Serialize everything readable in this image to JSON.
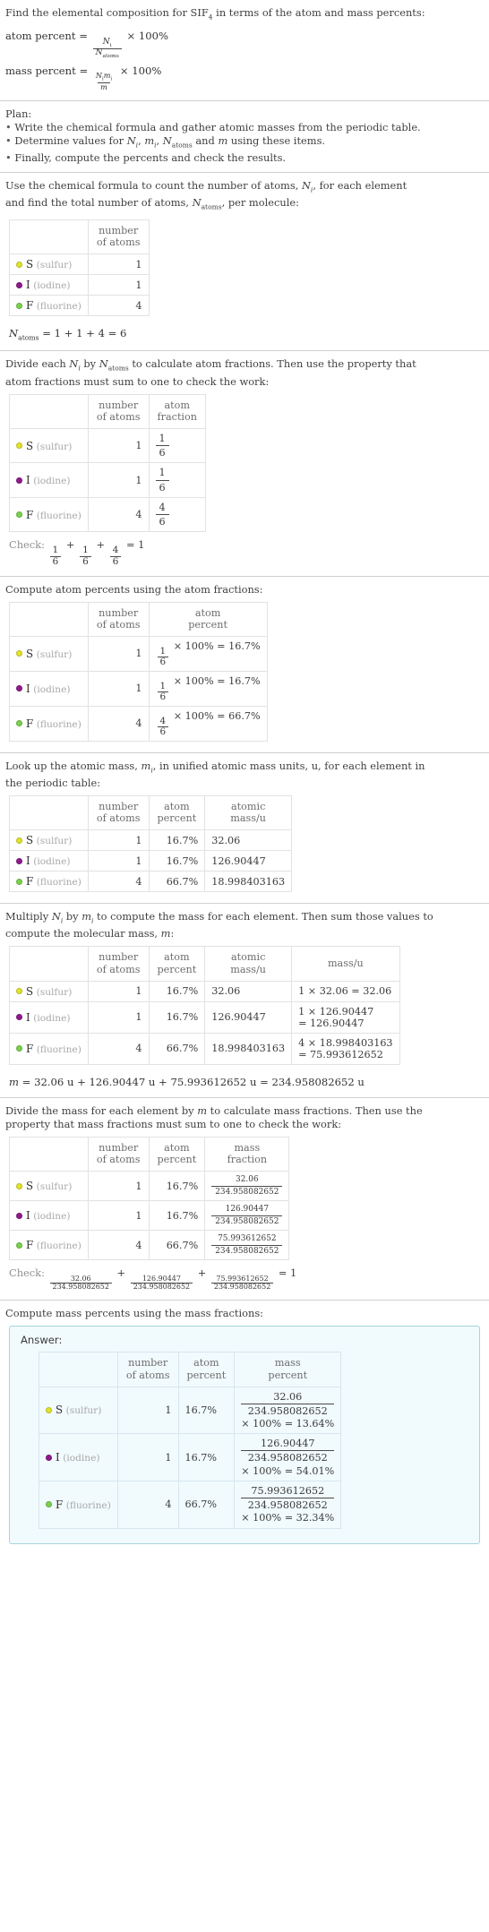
{
  "colors": {
    "sulfur": "#e3e32a",
    "iodine": "#8e1a8e",
    "fluorine": "#79d24f",
    "answer_border": "#a8d4de",
    "answer_bg": "#f1fafd",
    "rule": "#cfcfcf"
  },
  "header": {
    "prompt_prefix": "Find the elemental composition for SIF",
    "formula_sub": "4",
    "prompt_suffix": " in terms of the atom and mass percents:",
    "atom_percent_label": "atom percent = ",
    "atom_percent_num": "N",
    "atom_percent_num_sub": "i",
    "atom_percent_den": "N",
    "atom_percent_den_sub": "atoms",
    "atom_percent_tail": "× 100%",
    "mass_percent_label": "mass percent = ",
    "mass_percent_num": "N",
    "mass_percent_num_sub": "i",
    "mass_percent_num2": "m",
    "mass_percent_num2_sub": "i",
    "mass_percent_den": "m",
    "mass_percent_tail": "× 100%"
  },
  "plan": {
    "title": "Plan:",
    "bullets": [
      "Write the chemical formula and gather atomic masses from the periodic table.",
      "Determine values for Ni, mi, Natoms and m using these items.",
      "Finally, compute the percents and check the results."
    ],
    "bullet2_parts": {
      "a": "Determine values for ",
      "b": "N",
      "b_sub": "i",
      "c": ", ",
      "d": "m",
      "d_sub": "i",
      "e": ", ",
      "f": "N",
      "f_sub": "atoms",
      "g": " and ",
      "h": "m",
      "i": " using these items."
    }
  },
  "section_count": {
    "text_a": "Use the chemical formula to count the number of atoms, ",
    "text_b": "N",
    "text_b_sub": "i",
    "text_c": ", for each element",
    "text_d": "and find the total number of atoms, ",
    "text_e": "N",
    "text_e_sub": "atoms",
    "text_f": ", per molecule:",
    "headers": [
      "",
      "number of atoms"
    ],
    "header_lines": [
      [
        "number",
        "of atoms"
      ]
    ],
    "rows": [
      {
        "symbol": "S",
        "name": "(sulfur)",
        "color": "#e3e32a",
        "atoms": "1"
      },
      {
        "symbol": "I",
        "name": "(iodine)",
        "color": "#8e1a8e",
        "atoms": "1"
      },
      {
        "symbol": "F",
        "name": "(fluorine)",
        "color": "#79d24f",
        "atoms": "4"
      }
    ],
    "total_label": "N",
    "total_label_sub": "atoms",
    "total_expr": " = 1 + 1 + 4 = 6"
  },
  "section_fraction": {
    "text_a": "Divide each ",
    "text_b": "N",
    "text_b_sub": "i",
    "text_c": " by ",
    "text_d": "N",
    "text_d_sub": "atoms",
    "text_e": " to calculate atom fractions. Then use the property that",
    "text_f": "atom fractions must sum to one to check the work:",
    "header_lines": [
      [
        "number",
        "of atoms"
      ],
      [
        "atom",
        "fraction"
      ]
    ],
    "rows": [
      {
        "symbol": "S",
        "name": "(sulfur)",
        "color": "#e3e32a",
        "atoms": "1",
        "frac_n": "1",
        "frac_d": "6"
      },
      {
        "symbol": "I",
        "name": "(iodine)",
        "color": "#8e1a8e",
        "atoms": "1",
        "frac_n": "1",
        "frac_d": "6"
      },
      {
        "symbol": "F",
        "name": "(fluorine)",
        "color": "#79d24f",
        "atoms": "4",
        "frac_n": "4",
        "frac_d": "6"
      }
    ],
    "check_label": "Check: ",
    "check_terms": [
      {
        "n": "1",
        "d": "6"
      },
      {
        "n": "1",
        "d": "6"
      },
      {
        "n": "4",
        "d": "6"
      }
    ],
    "check_result": "= 1"
  },
  "section_atom_percent": {
    "text": "Compute atom percents using the atom fractions:",
    "header_lines": [
      [
        "number",
        "of atoms"
      ],
      [
        "atom",
        "percent"
      ]
    ],
    "rows": [
      {
        "symbol": "S",
        "name": "(sulfur)",
        "color": "#e3e32a",
        "atoms": "1",
        "frac_n": "1",
        "frac_d": "6",
        "expr": "× 100% = 16.7%"
      },
      {
        "symbol": "I",
        "name": "(iodine)",
        "color": "#8e1a8e",
        "atoms": "1",
        "frac_n": "1",
        "frac_d": "6",
        "expr": "× 100% = 16.7%"
      },
      {
        "symbol": "F",
        "name": "(fluorine)",
        "color": "#79d24f",
        "atoms": "4",
        "frac_n": "4",
        "frac_d": "6",
        "expr": "× 100% = 66.7%"
      }
    ]
  },
  "section_atomic_mass": {
    "text_a": "Look up the atomic mass, ",
    "text_b": "m",
    "text_b_sub": "i",
    "text_c": ", in unified atomic mass units, u, for each element in",
    "text_d": "the periodic table:",
    "header_lines": [
      [
        "number",
        "of atoms"
      ],
      [
        "atom",
        "percent"
      ],
      [
        "atomic",
        "mass/u"
      ]
    ],
    "rows": [
      {
        "symbol": "S",
        "name": "(sulfur)",
        "color": "#e3e32a",
        "atoms": "1",
        "percent": "16.7%",
        "mass": "32.06"
      },
      {
        "symbol": "I",
        "name": "(iodine)",
        "color": "#8e1a8e",
        "atoms": "1",
        "percent": "16.7%",
        "mass": "126.90447"
      },
      {
        "symbol": "F",
        "name": "(fluorine)",
        "color": "#79d24f",
        "atoms": "4",
        "percent": "66.7%",
        "mass": "18.998403163"
      }
    ]
  },
  "section_mass": {
    "text_a": "Multiply ",
    "text_b": "N",
    "text_b_sub": "i",
    "text_c": " by ",
    "text_d": "m",
    "text_d_sub": "i",
    "text_e": " to compute the mass for each element. Then sum those values to",
    "text_f": "compute the molecular mass, ",
    "text_g": "m",
    "text_h": ":",
    "header_lines": [
      [
        "number",
        "of atoms"
      ],
      [
        "atom",
        "percent"
      ],
      [
        "atomic",
        "mass/u"
      ],
      [
        "mass/u"
      ]
    ],
    "rows": [
      {
        "symbol": "S",
        "name": "(sulfur)",
        "color": "#e3e32a",
        "atoms": "1",
        "percent": "16.7%",
        "mass": "32.06",
        "calc_l1": "1 × 32.06 = 32.06",
        "calc_l2": ""
      },
      {
        "symbol": "I",
        "name": "(iodine)",
        "color": "#8e1a8e",
        "atoms": "1",
        "percent": "16.7%",
        "mass": "126.90447",
        "calc_l1": "1 × 126.90447",
        "calc_l2": "= 126.90447"
      },
      {
        "symbol": "F",
        "name": "(fluorine)",
        "color": "#79d24f",
        "atoms": "4",
        "percent": "66.7%",
        "mass": "18.998403163",
        "calc_l1": "4 × 18.998403163",
        "calc_l2": "= 75.993612652"
      }
    ],
    "total_label": "m",
    "total_expr": " = 32.06 u + 126.90447 u + 75.993612652 u = 234.958082652 u"
  },
  "section_mass_fraction": {
    "text_a": "Divide the mass for each element by ",
    "text_b": "m",
    "text_c": " to calculate mass fractions. Then use the",
    "text_d": "property that mass fractions must sum to one to check the work:",
    "header_lines": [
      [
        "number",
        "of atoms"
      ],
      [
        "atom",
        "percent"
      ],
      [
        "mass",
        "fraction"
      ]
    ],
    "rows": [
      {
        "symbol": "S",
        "name": "(sulfur)",
        "color": "#e3e32a",
        "atoms": "1",
        "percent": "16.7%",
        "frac_n": "32.06",
        "frac_d": "234.958082652"
      },
      {
        "symbol": "I",
        "name": "(iodine)",
        "color": "#8e1a8e",
        "atoms": "1",
        "percent": "16.7%",
        "frac_n": "126.90447",
        "frac_d": "234.958082652"
      },
      {
        "symbol": "F",
        "name": "(fluorine)",
        "color": "#79d24f",
        "atoms": "4",
        "percent": "66.7%",
        "frac_n": "75.993612652",
        "frac_d": "234.958082652"
      }
    ],
    "check_label": "Check: ",
    "check_terms": [
      {
        "n": "32.06",
        "d": "234.958082652"
      },
      {
        "n": "126.90447",
        "d": "234.958082652"
      },
      {
        "n": "75.993612652",
        "d": "234.958082652"
      }
    ],
    "check_result": "= 1"
  },
  "section_mass_percent": {
    "text": "Compute mass percents using the mass fractions:",
    "answer_label": "Answer:",
    "header_lines": [
      [
        "number",
        "of atoms"
      ],
      [
        "atom",
        "percent"
      ],
      [
        "mass",
        "percent"
      ]
    ],
    "rows": [
      {
        "symbol": "S",
        "name": "(sulfur)",
        "color": "#e3e32a",
        "atoms": "1",
        "percent": "16.7%",
        "frac_n": "32.06",
        "frac_d": "234.958082652",
        "tail": "× 100% = 13.64%"
      },
      {
        "symbol": "I",
        "name": "(iodine)",
        "color": "#8e1a8e",
        "atoms": "1",
        "percent": "16.7%",
        "frac_n": "126.90447",
        "frac_d": "234.958082652",
        "tail": "× 100% = 54.01%"
      },
      {
        "symbol": "F",
        "name": "(fluorine)",
        "color": "#79d24f",
        "atoms": "4",
        "percent": "66.7%",
        "frac_n": "75.993612652",
        "frac_d": "234.958082652",
        "tail": "× 100% = 32.34%"
      }
    ]
  }
}
